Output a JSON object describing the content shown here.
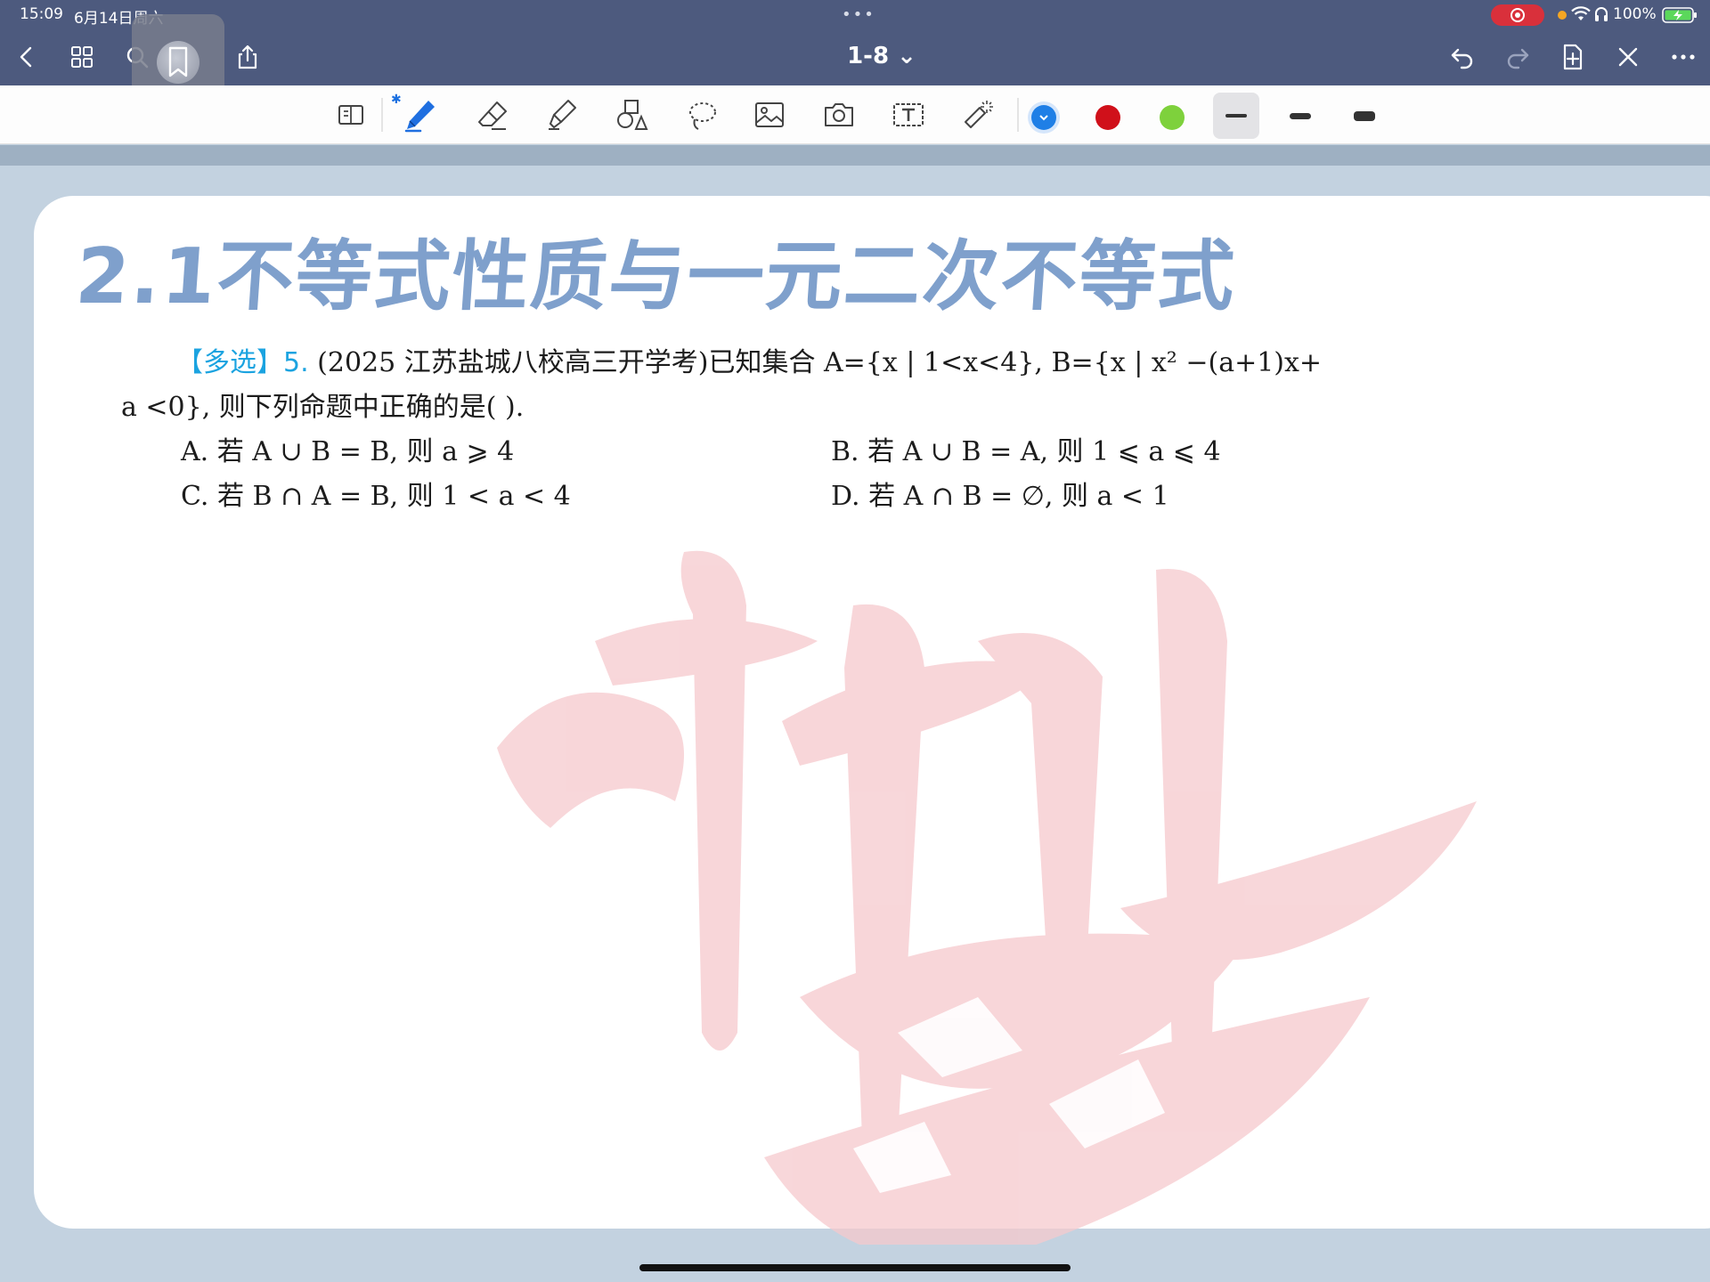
{
  "status_bar": {
    "time": "15:09",
    "date": "6月14日周六",
    "dots": "•••",
    "battery": "100%"
  },
  "nav": {
    "page_indicator": "1-8 ⌄"
  },
  "toolbar": {
    "colors": [
      "#1f7fe6",
      "#d0101a",
      "#7ed13c"
    ]
  },
  "document": {
    "title": "2.1不等式性质与一元二次不等式",
    "question": {
      "tag": "【多选】5.",
      "line1": " (2025 江苏盐城八校高三开学考)已知集合 A={x | 1<x<4}, B={x | x² −(a+1)x+",
      "line2": "a <0}, 则下列命题中正确的是(          ).",
      "options": [
        {
          "label": "A.",
          "text": "若 A ∪ B = B, 则 a ⩾ 4"
        },
        {
          "label": "B.",
          "text": "若 A ∪ B = A, 则 1 ⩽ a ⩽ 4"
        },
        {
          "label": "C.",
          "text": "若 B ∩ A = B, 则 1 < a < 4"
        },
        {
          "label": "D.",
          "text": "若 A ∩ B = ∅, 则 a < 1"
        }
      ]
    }
  }
}
